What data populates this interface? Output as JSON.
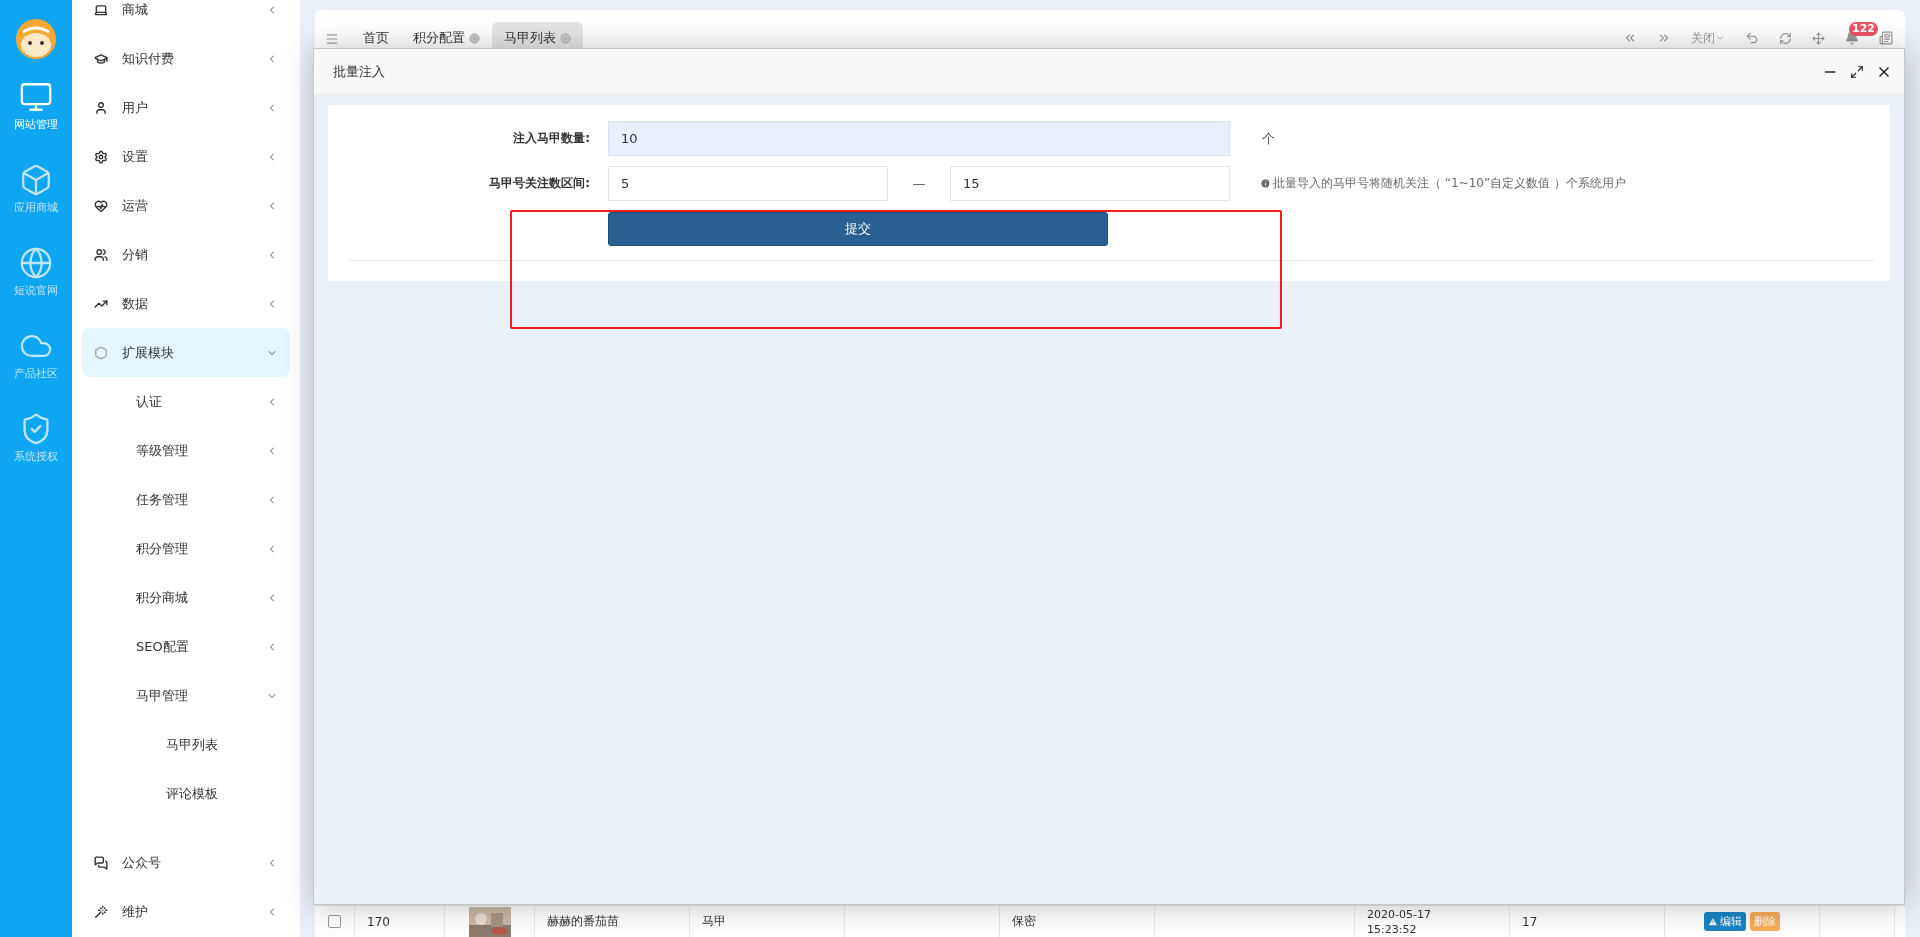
{
  "rail": {
    "items": [
      {
        "label": "网站管理",
        "selected": true
      },
      {
        "label": "应用商城",
        "selected": false
      },
      {
        "label": "短说官网",
        "selected": false
      },
      {
        "label": "产品社区",
        "selected": false
      },
      {
        "label": "系统授权",
        "selected": false
      }
    ]
  },
  "sidebar": {
    "items": [
      {
        "label": "商城",
        "kind": "group",
        "expanded": false,
        "selected": false
      },
      {
        "label": "知识付费",
        "kind": "group",
        "expanded": false,
        "selected": false
      },
      {
        "label": "用户",
        "kind": "group",
        "expanded": false,
        "selected": false
      },
      {
        "label": "设置",
        "kind": "group",
        "expanded": false,
        "selected": false
      },
      {
        "label": "运营",
        "kind": "group",
        "expanded": false,
        "selected": false
      },
      {
        "label": "分销",
        "kind": "group",
        "expanded": false,
        "selected": false
      },
      {
        "label": "数据",
        "kind": "group",
        "expanded": false,
        "selected": false
      },
      {
        "label": "扩展模块",
        "kind": "group",
        "expanded": true,
        "selected": true,
        "children": [
          {
            "label": "认证",
            "kind": "group",
            "expanded": false
          },
          {
            "label": "等级管理",
            "kind": "group",
            "expanded": false
          },
          {
            "label": "任务管理",
            "kind": "group",
            "expanded": false
          },
          {
            "label": "积分管理",
            "kind": "group",
            "expanded": false
          },
          {
            "label": "积分商城",
            "kind": "group",
            "expanded": false
          },
          {
            "label": "SEO配置",
            "kind": "group",
            "expanded": false
          },
          {
            "label": "马甲管理",
            "kind": "group",
            "expanded": true,
            "children": [
              {
                "label": "马甲列表",
                "kind": "link"
              },
              {
                "label": "评论模板",
                "kind": "link"
              }
            ]
          }
        ]
      },
      {
        "label": "公众号",
        "kind": "group",
        "expanded": false,
        "selected": false
      },
      {
        "label": "维护",
        "kind": "group",
        "expanded": false,
        "selected": false
      }
    ]
  },
  "tabs": [
    {
      "label": "首页",
      "closable": false,
      "selected": false
    },
    {
      "label": "积分配置",
      "closable": true,
      "selected": false
    },
    {
      "label": "马甲列表",
      "closable": true,
      "selected": true
    }
  ],
  "toolbar": {
    "close_menu": "关闭",
    "notification_count": "122"
  },
  "modal": {
    "title": "批量注入",
    "form": {
      "quantity": {
        "label": "注入马甲数量:",
        "value": "10",
        "unit": "个",
        "focused": true
      },
      "range": {
        "label": "马甲号关注数区间:",
        "min": "5",
        "separator": "—",
        "max": "15",
        "focused": false,
        "hint": "批量导入的马甲号将随机关注（ “1~10”自定义数值 ）个系统用户"
      },
      "submit": "提交"
    }
  },
  "table": {
    "rows": [
      {
        "checked": false,
        "cells": [
          "170",
          "赫赫的番茄苗",
          "马甲",
          "保密",
          "2020-05-17",
          "15:23:52",
          "17"
        ],
        "actions": [
          "编辑",
          "删除"
        ]
      }
    ]
  }
}
